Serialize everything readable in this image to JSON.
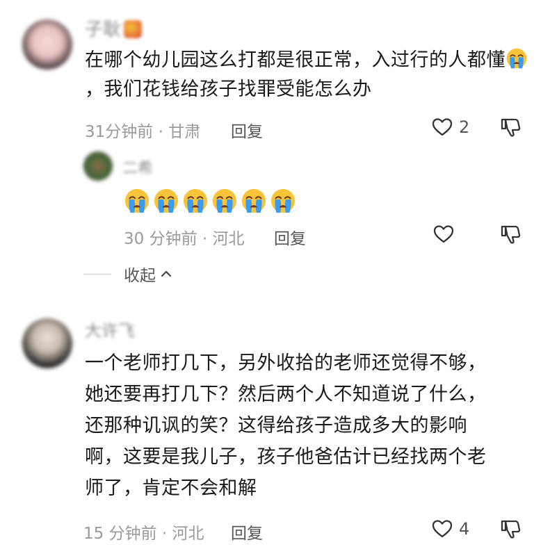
{
  "comments": [
    {
      "username": "子耿",
      "text": "在哪个幼儿园这么打都是很正常，入过行的人都懂",
      "text_tail": "，我们花钱给孩子找罪受能怎么办",
      "time": "31分钟前",
      "location": "甘肃",
      "reply_label": "回复",
      "likes": "2"
    },
    {
      "username": "二希",
      "time": "30 分钟前",
      "location": "河北",
      "reply_label": "回复",
      "likes": ""
    },
    {
      "username": "大许飞",
      "lines": [
        "一个老师打几下，另外收拾的老师还觉得不够，",
        "她还要再打几下？然后两个人不知道说了什么，",
        "还那种讥讽的笑？这得给孩子造成多大的影响",
        "啊，这要是我儿子，孩子他爸估计已经找两个老",
        "师了，肯定不会和解"
      ],
      "time": "15 分钟前",
      "location": "河北",
      "reply_label": "回复",
      "likes": "4"
    }
  ],
  "collapse_label": "收起",
  "separator": " · ",
  "icons": {
    "like": "heart-outline-icon",
    "dislike": "thumbs-down-outline-icon",
    "emoji": "loudly-crying-face-icon",
    "collapse": "chevron-up-icon"
  },
  "colors": {
    "text": "#1a1a1a",
    "meta": "#9a9a9a",
    "icon": "#333333"
  }
}
